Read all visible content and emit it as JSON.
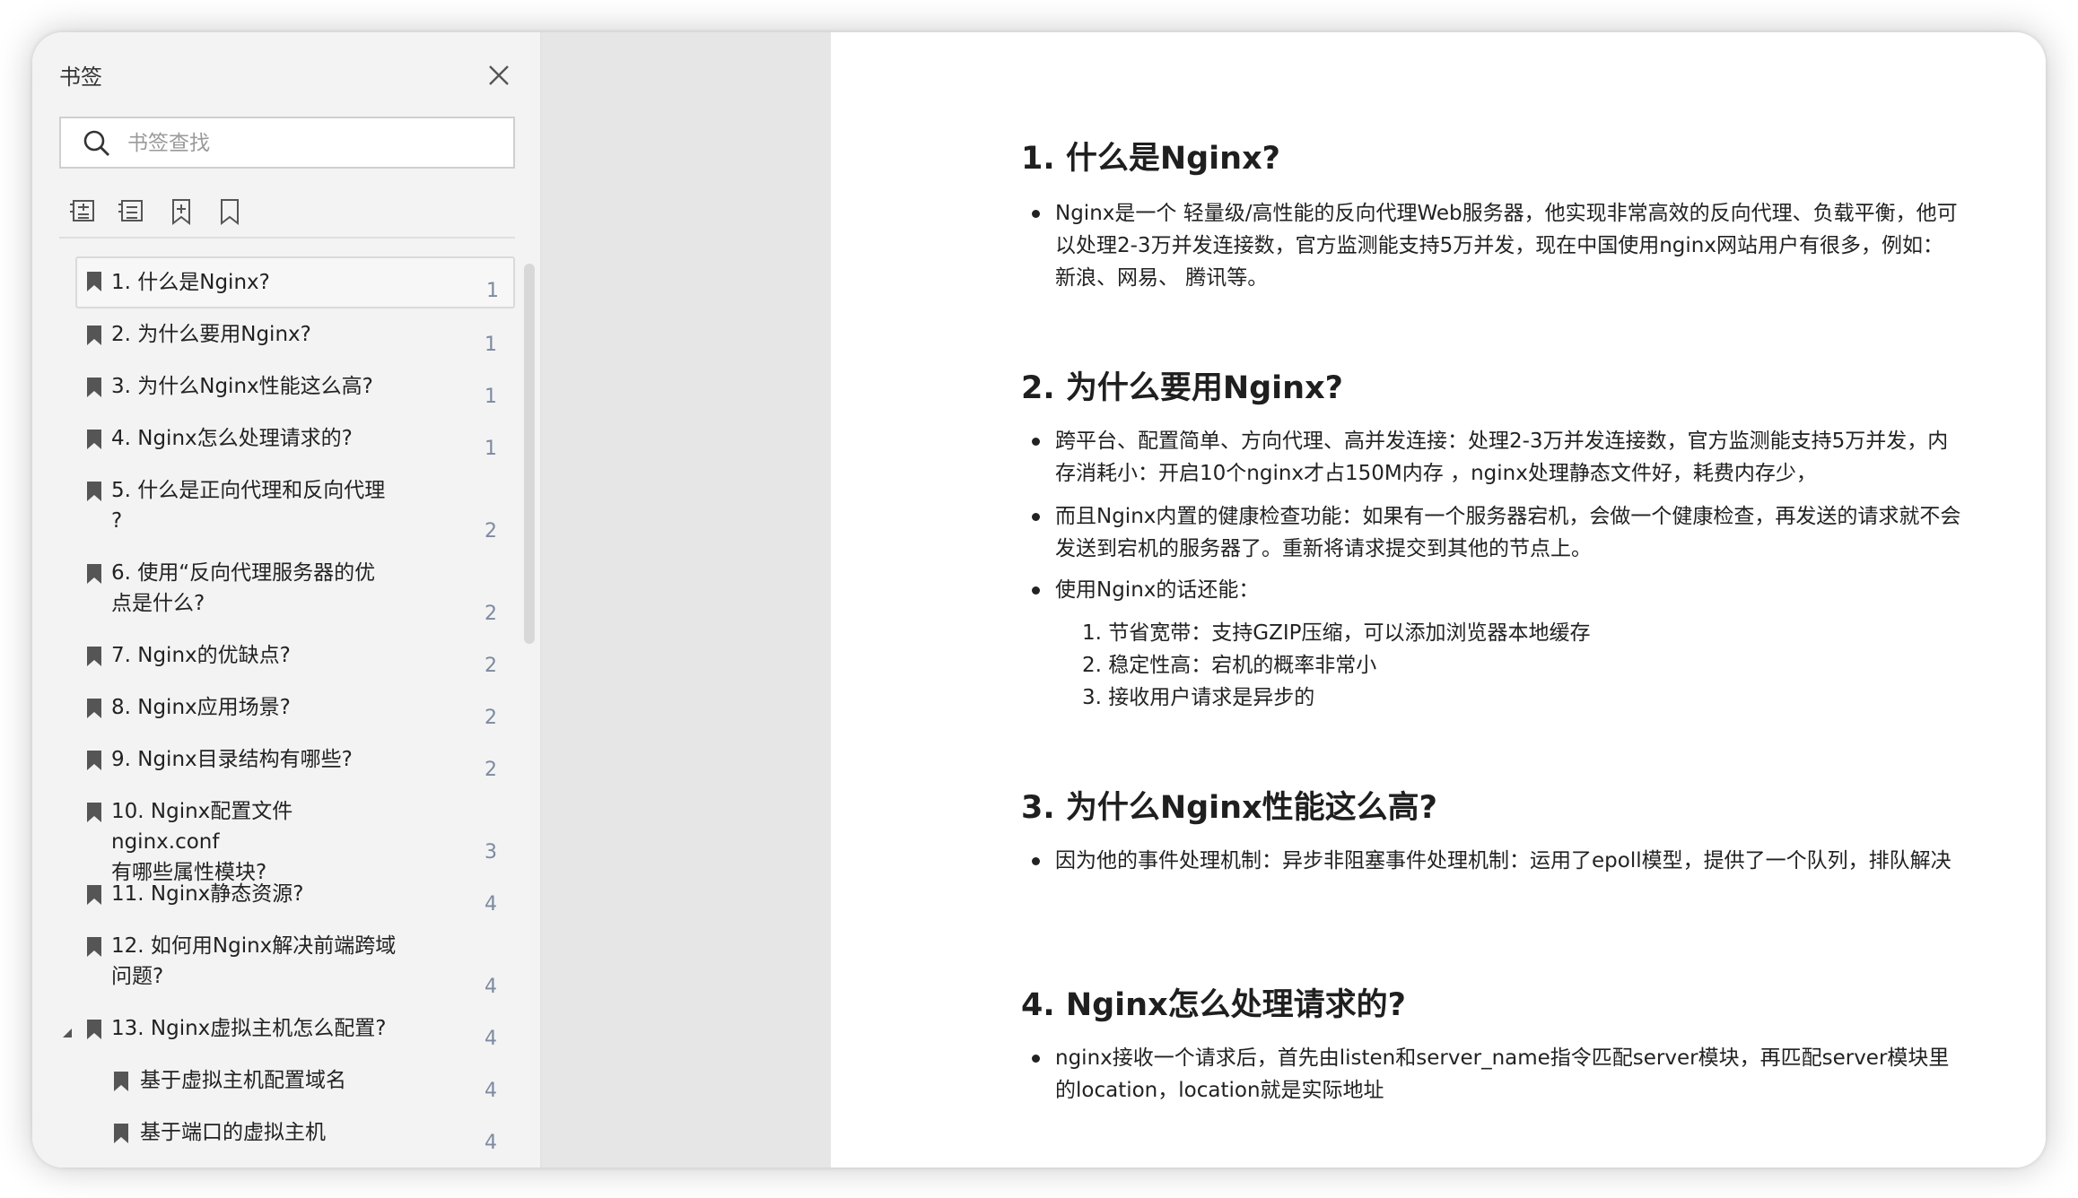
{
  "sidebar": {
    "title": "书签",
    "search_placeholder": "书签查找",
    "bookmarks": [
      {
        "label": "1. 什么是Nginx?",
        "page": "1"
      },
      {
        "label": "2. 为什么要用Nginx?",
        "page": "1"
      },
      {
        "label": "3. 为什么Nginx性能这么高?",
        "page": "1"
      },
      {
        "label": "4. Nginx怎么处理请求的?",
        "page": "1"
      },
      {
        "label": "5. 什么是正向代理和反向代理\n?",
        "page": "2"
      },
      {
        "label": "6. 使用“反向代理服务器的优\n点是什么?",
        "page": "2"
      },
      {
        "label": "7. Nginx的优缺点?",
        "page": "2"
      },
      {
        "label": "8. Nginx应用场景?",
        "page": "2"
      },
      {
        "label": "9. Nginx目录结构有哪些?",
        "page": "2"
      },
      {
        "label": "10. Nginx配置文件nginx.conf\n有哪些属性模块?",
        "page": "3"
      },
      {
        "label": "11. Nginx静态资源?",
        "page": "4"
      },
      {
        "label": "12. 如何用Nginx解决前端跨域\n问题?",
        "page": "4"
      },
      {
        "label": "13. Nginx虚拟主机怎么配置?",
        "page": "4"
      },
      {
        "label": "基于虚拟主机配置域名",
        "page": "4"
      },
      {
        "label": "基于端口的虚拟主机",
        "page": "4"
      }
    ]
  },
  "document": {
    "s1_title": "1. 什么是Nginx?",
    "s1_b1": "Nginx是一个 轻量级/高性能的反向代理Web服务器，他实现非常高效的反向代理、负载平衡，他可以处理2-3万并发连接数，官方监测能支持5万并发，现在中国使用nginx网站用户有很多，例如：新浪、网易、 腾讯等。",
    "s2_title": "2. 为什么要用Nginx?",
    "s2_b1": "跨平台、配置简单、方向代理、高并发连接：处理2-3万并发连接数，官方监测能支持5万并发，内存消耗小：开启10个nginx才占150M内存 ，nginx处理静态文件好，耗费内存少，",
    "s2_b2": "而且Nginx内置的健康检查功能：如果有一个服务器宕机，会做一个健康检查，再发送的请求就不会发送到宕机的服务器了。重新将请求提交到其他的节点上。",
    "s2_b3": "使用Nginx的话还能：",
    "s2_sub1": "1. 节省宽带：支持GZIP压缩，可以添加浏览器本地缓存",
    "s2_sub2": "2. 稳定性高：宕机的概率非常小",
    "s2_sub3": "3. 接收用户请求是异步的",
    "s3_title": "3. 为什么Nginx性能这么高?",
    "s3_b1": "因为他的事件处理机制：异步非阻塞事件处理机制：运用了epoll模型，提供了一个队列，排队解决",
    "s4_title": "4. Nginx怎么处理请求的?",
    "s4_b1": "nginx接收一个请求后，首先由listen和server_name指令匹配server模块，再匹配server模块里的location，location就是实际地址"
  }
}
